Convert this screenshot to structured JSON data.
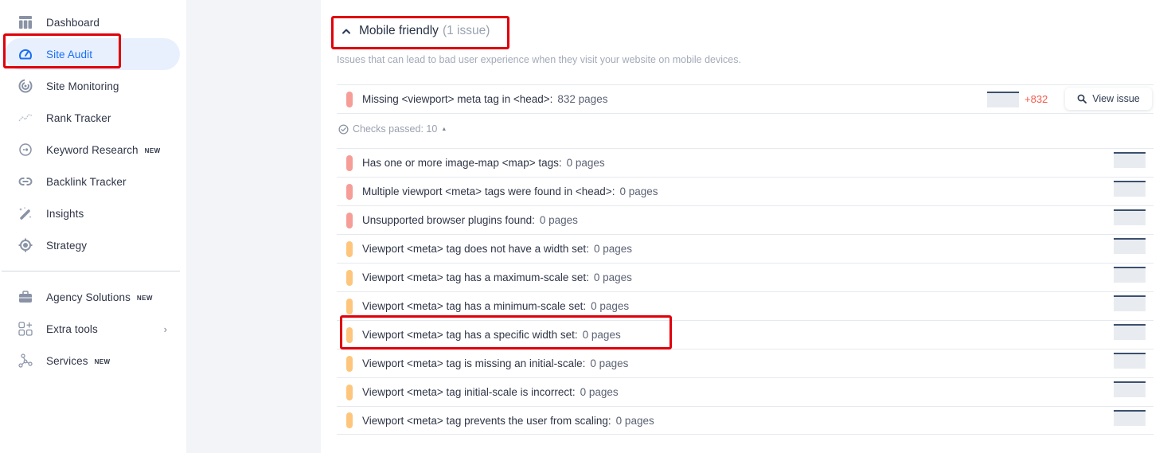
{
  "sidebar": {
    "items": [
      {
        "label": "Dashboard",
        "icon": "dashboard-icon",
        "badge": null
      },
      {
        "label": "Site Audit",
        "icon": "gauge-icon",
        "badge": null,
        "active": true
      },
      {
        "label": "Site Monitoring",
        "icon": "radar-icon",
        "badge": null
      },
      {
        "label": "Rank Tracker",
        "icon": "trend-line-icon",
        "badge": null
      },
      {
        "label": "Keyword Research",
        "icon": "keyword-icon",
        "badge": "NEW"
      },
      {
        "label": "Backlink Tracker",
        "icon": "link-icon",
        "badge": null
      },
      {
        "label": "Insights",
        "icon": "magic-wand-icon",
        "badge": null
      },
      {
        "label": "Strategy",
        "icon": "target-icon",
        "badge": null
      }
    ],
    "secondary_items": [
      {
        "label": "Agency Solutions",
        "icon": "briefcase-icon",
        "badge": "NEW"
      },
      {
        "label": "Extra tools",
        "icon": "apps-plus-icon",
        "badge": null,
        "has_submenu": true
      },
      {
        "label": "Services",
        "icon": "nodes-icon",
        "badge": "NEW"
      }
    ]
  },
  "section": {
    "title": "Mobile friendly",
    "issue_count": "(1 issue)",
    "description": "Issues that can lead to bad user experience when they visit your website on mobile devices."
  },
  "issues": [
    {
      "label": "Missing <viewport> meta tag in <head>:",
      "count": "832 pages",
      "severity": "error",
      "delta": "+832",
      "action": "View issue"
    }
  ],
  "checks_passed": {
    "label": "Checks passed: 10",
    "caret": "▲"
  },
  "checks": [
    {
      "label": "Has one or more image-map <map> tags:",
      "count": "0 pages",
      "severity": "error"
    },
    {
      "label": "Multiple viewport <meta> tags were found in <head>:",
      "count": "0 pages",
      "severity": "error"
    },
    {
      "label": "Unsupported browser plugins found:",
      "count": "0 pages",
      "severity": "error"
    },
    {
      "label": "Viewport <meta> tag does not have a width set:",
      "count": "0 pages",
      "severity": "warning"
    },
    {
      "label": "Viewport <meta> tag has a maximum-scale set:",
      "count": "0 pages",
      "severity": "warning"
    },
    {
      "label": "Viewport <meta> tag has a minimum-scale set:",
      "count": "0 pages",
      "severity": "warning"
    },
    {
      "label": "Viewport <meta> tag has a specific width set:",
      "count": "0 pages",
      "severity": "warning"
    },
    {
      "label": "Viewport <meta> tag is missing an initial-scale:",
      "count": "0 pages",
      "severity": "warning"
    },
    {
      "label": "Viewport <meta> tag initial-scale is incorrect:",
      "count": "0 pages",
      "severity": "warning"
    },
    {
      "label": "Viewport <meta> tag prevents the user from scaling:",
      "count": "0 pages",
      "severity": "warning"
    }
  ],
  "colors": {
    "accent": "#1a6ef5",
    "active_bg": "#e8f0fe",
    "error": "#f59d96",
    "warning": "#fdc67c",
    "delta": "#f05a4a",
    "highlight": "#e0000b"
  }
}
